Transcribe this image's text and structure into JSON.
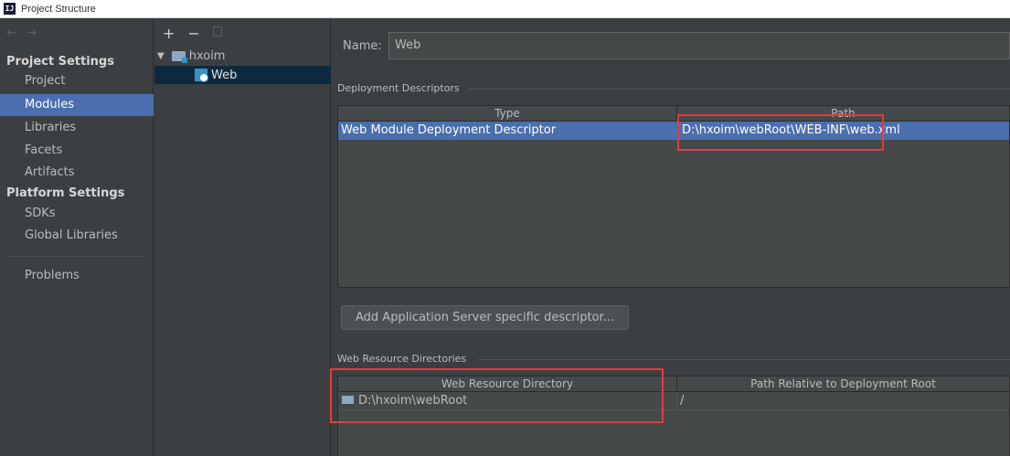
{
  "window": {
    "title": "Project Structure",
    "logo_text": "IJ"
  },
  "sidebar": {
    "nav_back": "←",
    "nav_forward": "→",
    "project_settings_header": "Project Settings",
    "project_items": [
      "Project",
      "Modules",
      "Libraries",
      "Facets",
      "Artifacts"
    ],
    "platform_settings_header": "Platform Settings",
    "platform_items": [
      "SDKs",
      "Global Libraries"
    ],
    "problems": "Problems",
    "selected": "Modules"
  },
  "tree": {
    "toolbar": {
      "add": "+",
      "remove": "−"
    },
    "root": {
      "label": "hxoim",
      "expander": "▼"
    },
    "child": {
      "label": "Web"
    }
  },
  "main": {
    "name_label": "Name:",
    "name_value": "Web",
    "deployment": {
      "title": "Deployment Descriptors",
      "columns": [
        "Type",
        "Path"
      ],
      "rows": [
        {
          "type": "Web Module Deployment Descriptor",
          "path": "D:\\hxoim\\webRoot\\WEB-INF\\web.xml"
        }
      ],
      "add_button": "Add Application Server specific descriptor..."
    },
    "web_resources": {
      "title": "Web Resource Directories",
      "columns": [
        "Web Resource Directory",
        "Path Relative to Deployment Root"
      ],
      "rows": [
        {
          "dir": "D:\\hxoim\\webRoot",
          "relative": "/"
        }
      ]
    }
  },
  "colors": {
    "background": "#3c3f41",
    "selection": "#4b6eaf",
    "tree_selection": "#0d293e",
    "highlight": "#e53b3b"
  }
}
